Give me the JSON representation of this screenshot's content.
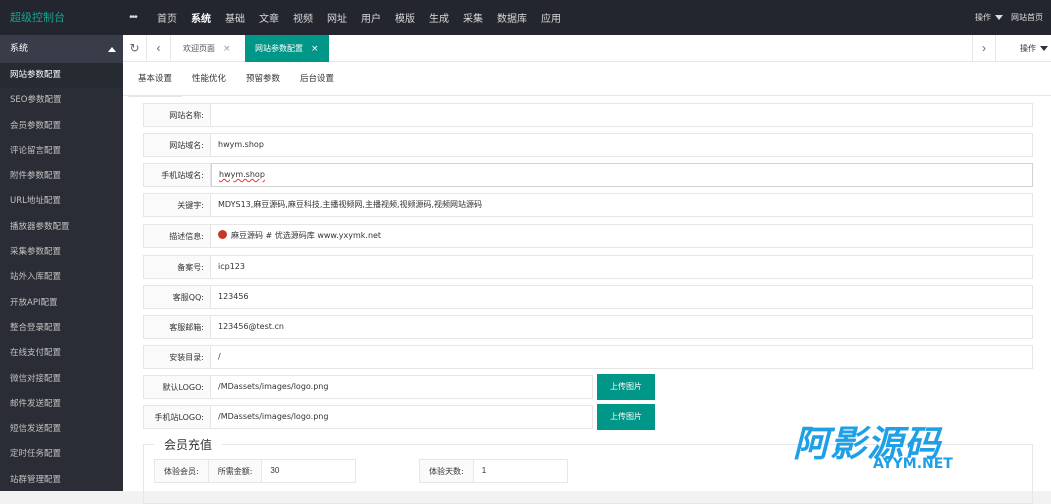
{
  "app": {
    "logo": "超级控制台",
    "dots": "•••",
    "nav": [
      "首页",
      "系统",
      "基础",
      "文章",
      "视频",
      "网址",
      "用户",
      "模版",
      "生成",
      "采集",
      "数据库",
      "应用"
    ],
    "active_nav": "系统",
    "top_right": {
      "operate": "操作",
      "site_home": "网站首页"
    }
  },
  "sidebar": {
    "header": "系统",
    "items": [
      "网站参数配置",
      "SEO参数配置",
      "会员参数配置",
      "评论留言配置",
      "附件参数配置",
      "URL地址配置",
      "播放器参数配置",
      "采集参数配置",
      "站外入库配置",
      "开放API配置",
      "整合登录配置",
      "在线支付配置",
      "微信对接配置",
      "邮件发送配置",
      "短信发送配置",
      "定时任务配置",
      "站群管理配置"
    ]
  },
  "tabs": {
    "items": [
      {
        "label": "欢迎页面",
        "close": "×"
      },
      {
        "label": "网站参数配置",
        "close": "×"
      }
    ],
    "operate": "操作"
  },
  "subtabs": [
    "基本设置",
    "性能优化",
    "预留参数",
    "后台设置"
  ],
  "form": {
    "site_name": {
      "label": "网站名称:",
      "value": ""
    },
    "domain": {
      "label": "网站域名:",
      "value": "hwym.shop"
    },
    "mobile_domain": {
      "label": "手机站域名:",
      "value": "hwym.shop"
    },
    "keywords": {
      "label": "关键字:",
      "value": "MDYS13,麻豆源码,麻豆科技,主播视频网,主播视频,视频源码,视频网站源码"
    },
    "description": {
      "label": "描述信息:",
      "value": "麻豆源码 # 优选源码库  www.yxymk.net"
    },
    "icp": {
      "label": "备案号:",
      "value": "icp123"
    },
    "qq": {
      "label": "客服QQ:",
      "value": "123456"
    },
    "email": {
      "label": "客服邮箱:",
      "value": "123456@test.cn"
    },
    "install_dir": {
      "label": "安装目录:",
      "value": "/"
    },
    "logo": {
      "label": "默认LOGO:",
      "value": "/MDassets/images/logo.png",
      "button": "上传图片"
    },
    "mobile_logo": {
      "label": "手机站LOGO:",
      "value": "/MDassets/images/logo.png",
      "button": "上传图片"
    }
  },
  "member": {
    "legend": "会员充值",
    "trial_label": "体验会员:",
    "amount_label": "所需金额:",
    "amount_value": "30",
    "days_label": "体验天数:",
    "days_value": "1"
  },
  "watermark": {
    "big": "阿影源码",
    "small": "AYYM.NET"
  },
  "colors": {
    "accent": "#009688",
    "topbar": "#23262e",
    "sidebar": "#2a2d35",
    "logo": "#1aa094",
    "watermark": "#1e9fe6"
  }
}
